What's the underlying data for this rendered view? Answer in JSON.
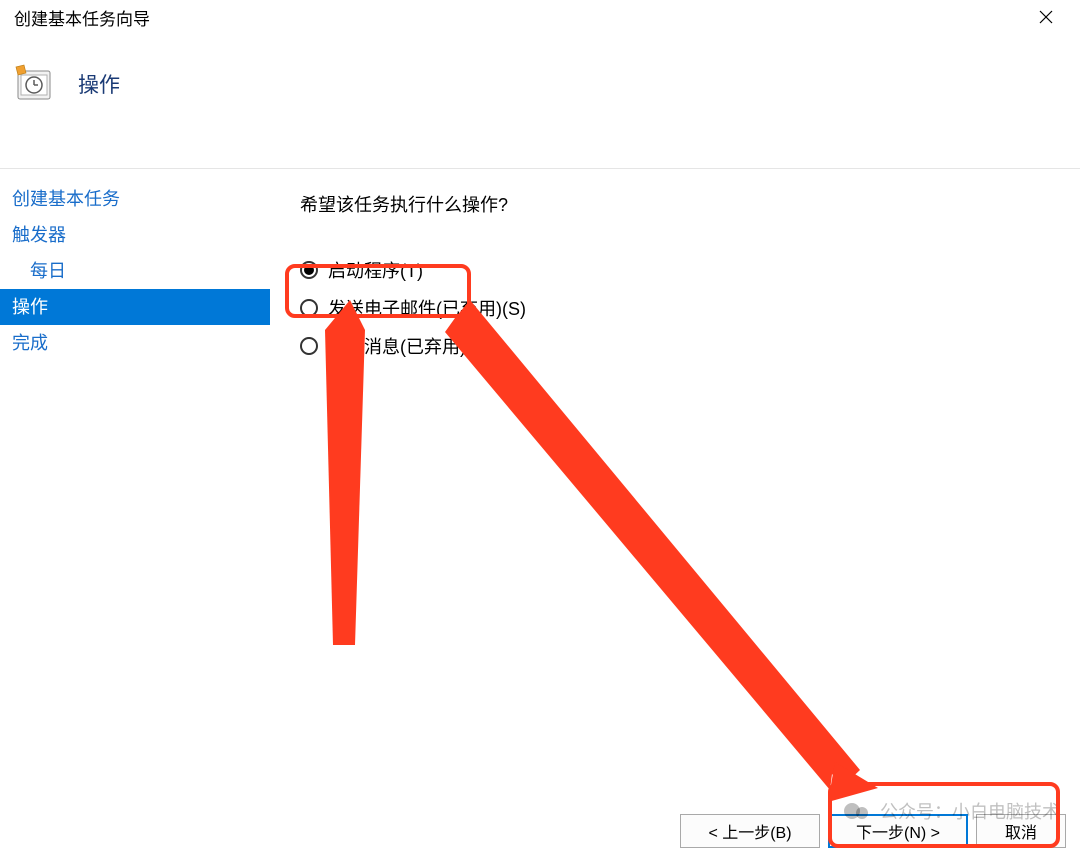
{
  "window": {
    "title": "创建基本任务向导",
    "close_icon": "close-icon"
  },
  "header": {
    "page_title": "操作"
  },
  "sidebar": {
    "items": [
      {
        "label": "创建基本任务",
        "indented": false,
        "active": false
      },
      {
        "label": "触发器",
        "indented": false,
        "active": false
      },
      {
        "label": "每日",
        "indented": true,
        "active": false
      },
      {
        "label": "操作",
        "indented": false,
        "active": true
      },
      {
        "label": "完成",
        "indented": false,
        "active": false
      }
    ]
  },
  "main": {
    "question": "希望该任务执行什么操作?",
    "options": [
      {
        "label": "启动程序(T)",
        "checked": true
      },
      {
        "label": "发送电子邮件(已弃用)(S)",
        "checked": false
      },
      {
        "label": "显示消息(已弃用)(M)",
        "checked": false
      }
    ]
  },
  "footer": {
    "back_label": "< 上一步(B)",
    "next_label": "下一步(N) >",
    "cancel_label": "取消"
  },
  "watermark": {
    "text": "公众号：小白电脑技术"
  },
  "colors": {
    "accent": "#0078d7",
    "annotation": "#ff3b1f",
    "link": "#196dca"
  }
}
